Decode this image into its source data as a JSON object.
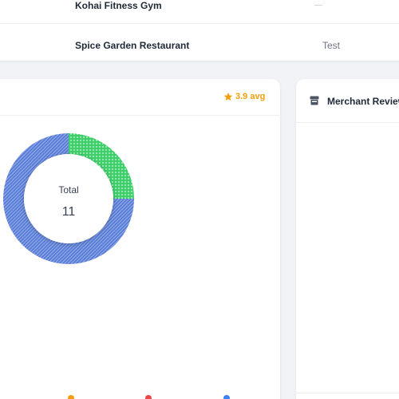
{
  "merchants_table": {
    "rows": [
      {
        "name": "Kohai Fitness Gym",
        "value": ""
      },
      {
        "name": "Spice Garden Restaurant",
        "value": "Test"
      }
    ]
  },
  "ratings_card": {
    "avg_label": "3.9 avg",
    "donut": {
      "center_label": "Total",
      "center_value": "11",
      "segments": [
        {
          "fraction": 0.25,
          "color": "#3ecf6a"
        },
        {
          "fraction": 0.75,
          "color": "#5b7fd8"
        }
      ]
    },
    "legend_colors": [
      "#f59e0b",
      "#ef4444",
      "#3b82f6"
    ]
  },
  "reviews_card": {
    "title": "Merchant Reviews"
  },
  "colors": {
    "accent_star": "#f59e0b",
    "donut_green": "#3ecf6a",
    "donut_blue": "#5b7fd8"
  }
}
